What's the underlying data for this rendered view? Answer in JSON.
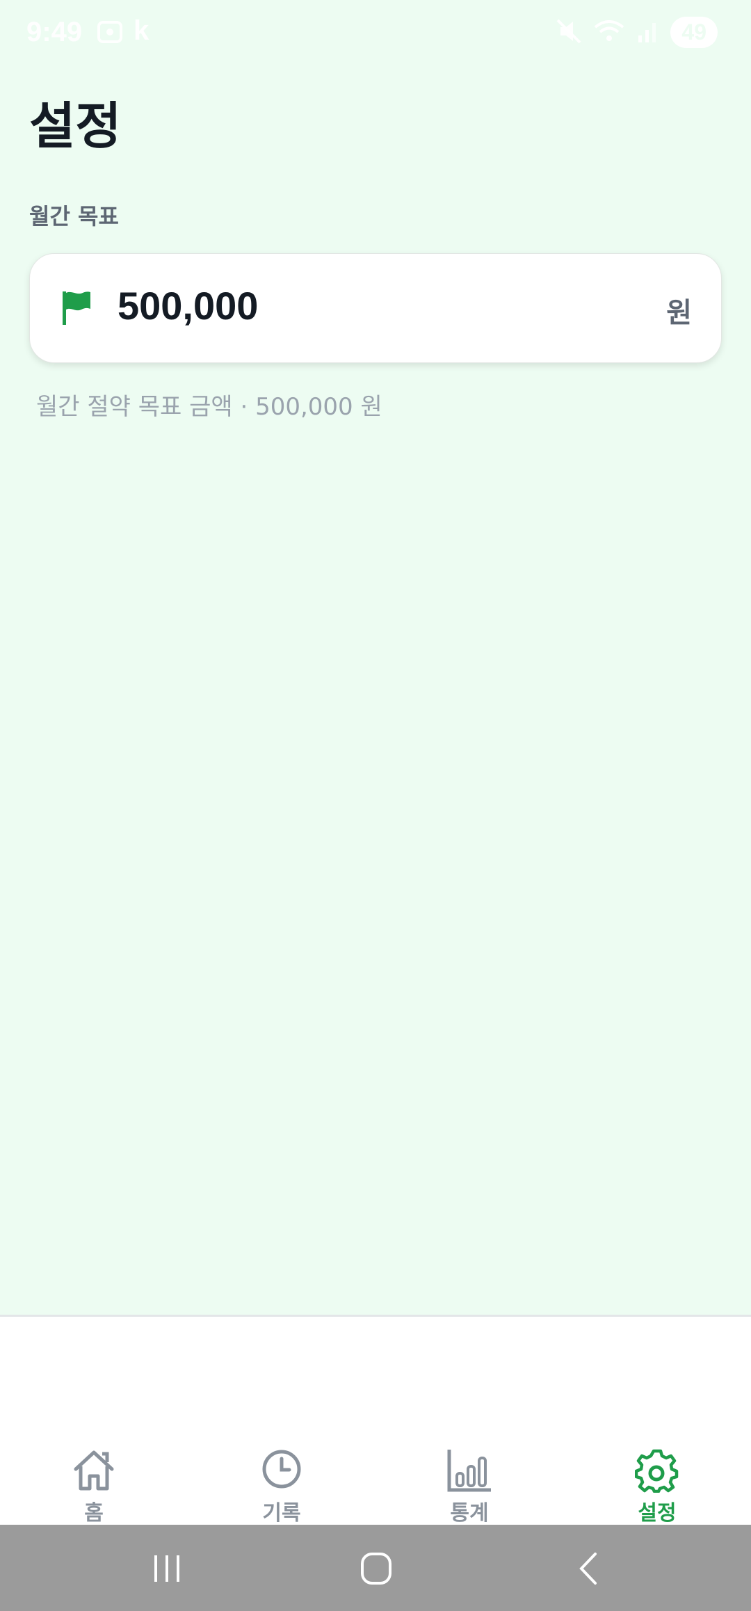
{
  "status_bar": {
    "time": "9:49",
    "carrier_letter": "k",
    "battery": "49",
    "icons": [
      "screenshot-icon",
      "mute-icon",
      "wifi-icon",
      "signal-icon"
    ]
  },
  "page": {
    "title": "설정"
  },
  "goal_section": {
    "label": "월간 목표",
    "value": "500,000",
    "unit": "원",
    "icon": "flag-icon",
    "helper": "월간 절약 목표 금액 · 500,000 원"
  },
  "tabs": [
    {
      "label": "홈",
      "icon": "home-icon",
      "active": false
    },
    {
      "label": "기록",
      "icon": "clock-icon",
      "active": false
    },
    {
      "label": "통계",
      "icon": "bar-chart-icon",
      "active": false
    },
    {
      "label": "설정",
      "icon": "gear-icon",
      "active": true
    }
  ],
  "colors": {
    "background": "#edfcf2",
    "accent": "#1f9d4a",
    "text_primary": "#141b24",
    "text_secondary": "#5d6673",
    "text_muted": "#9aa3ad",
    "tab_inactive": "#8a929c",
    "system_nav": "#9b9b9b"
  },
  "system_nav": [
    "recents-icon",
    "home-circle-icon",
    "back-icon"
  ]
}
